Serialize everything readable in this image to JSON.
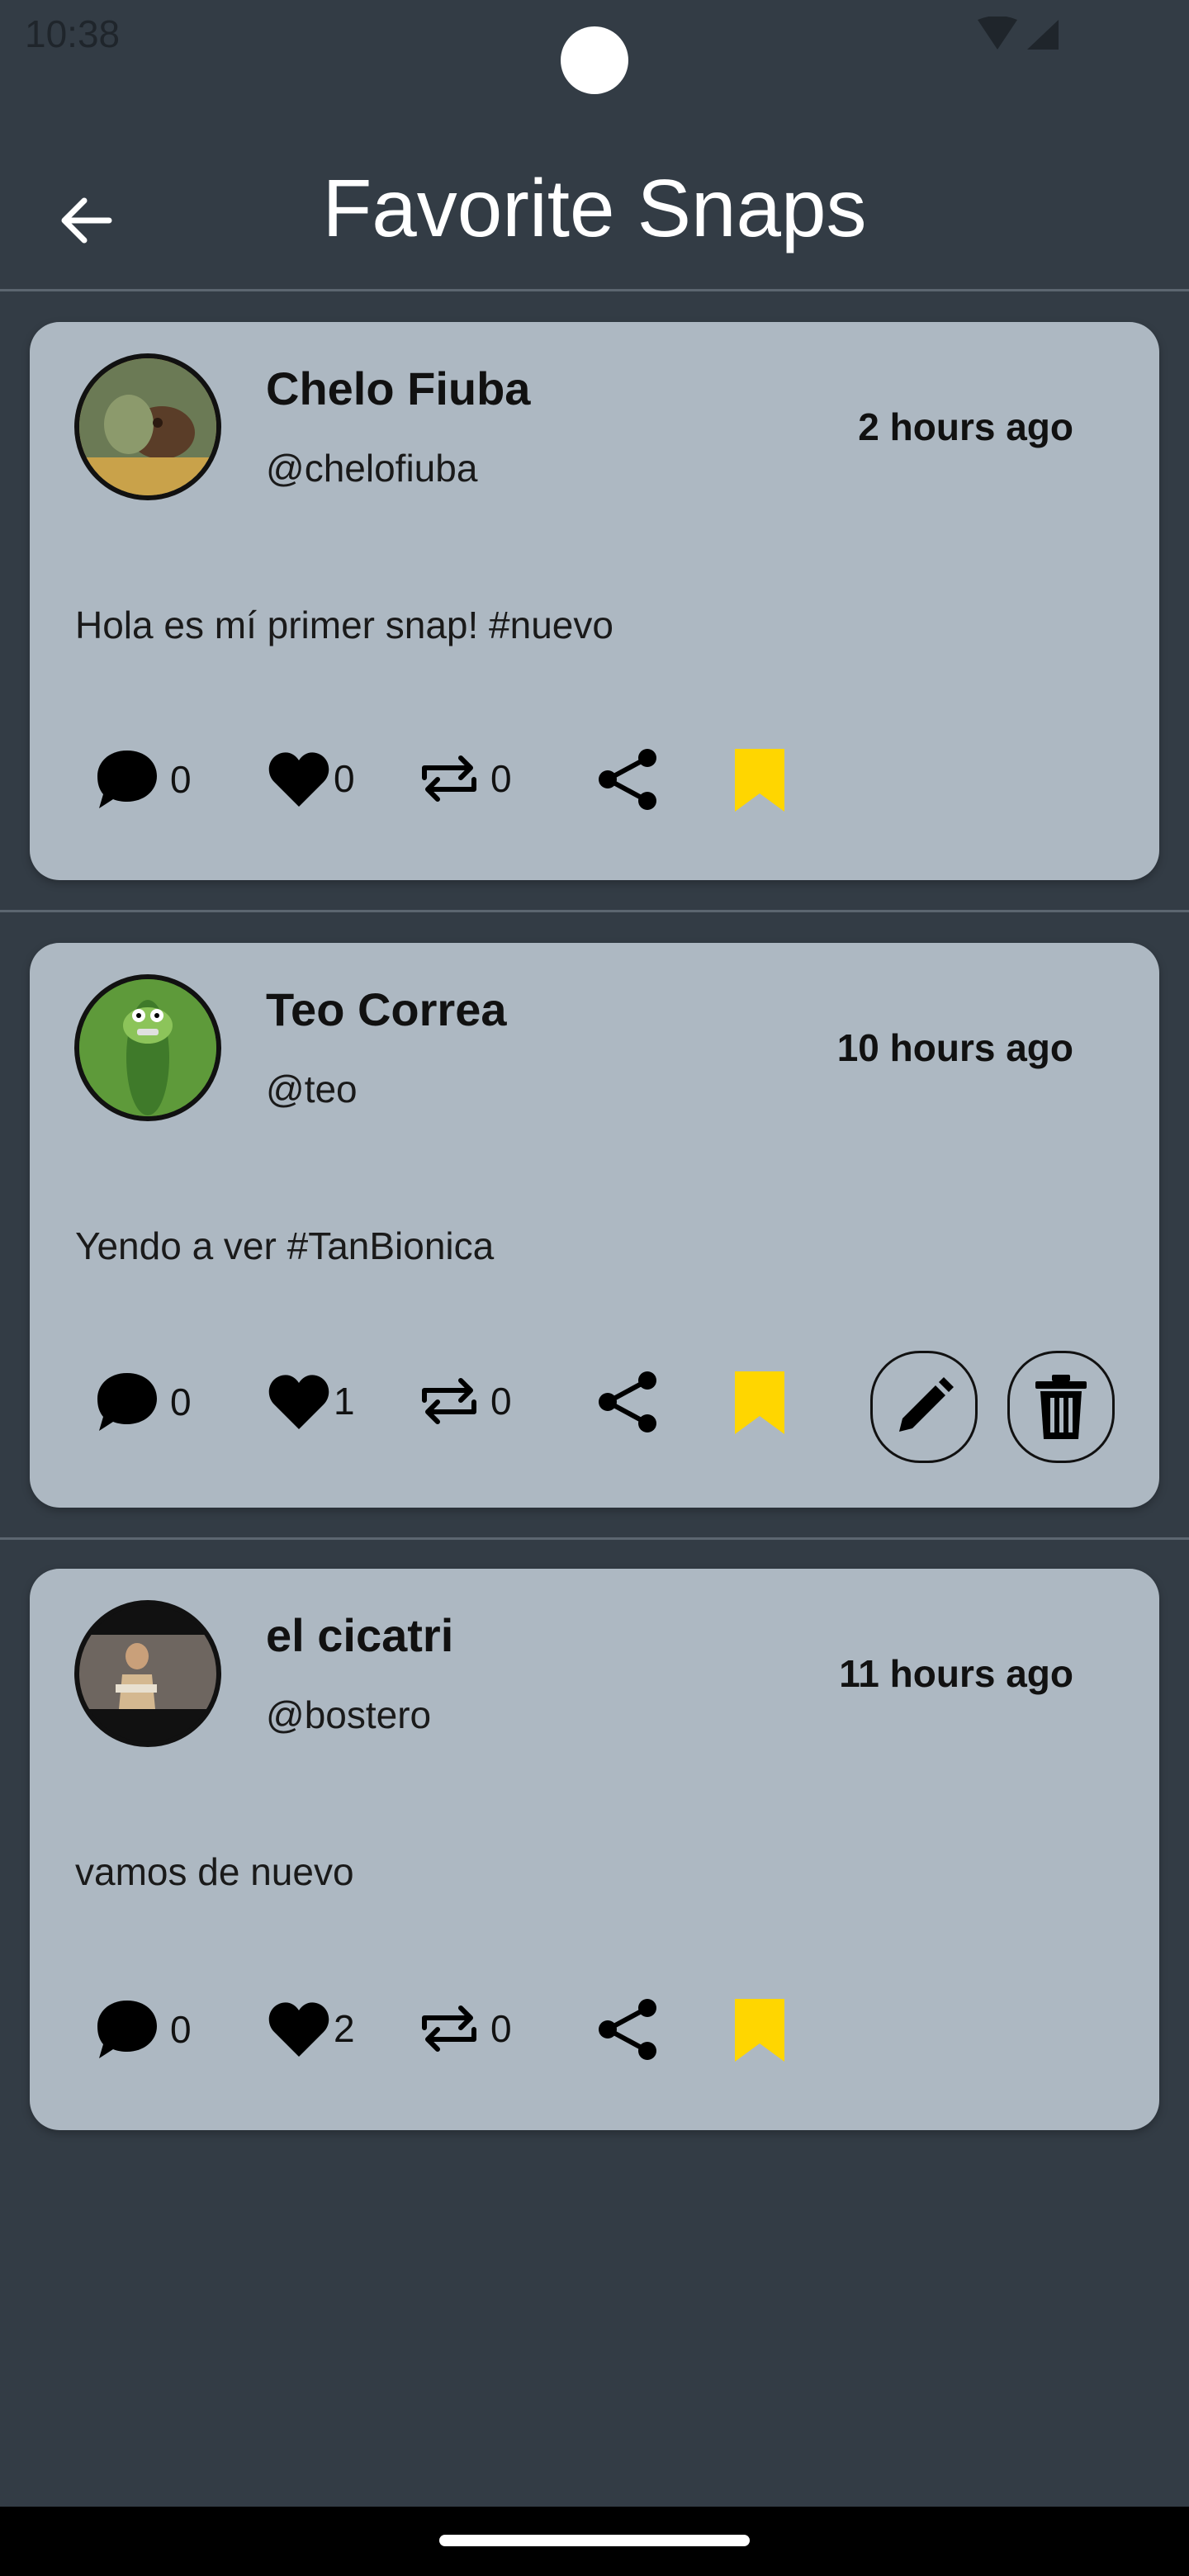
{
  "status_bar": {
    "time": "10:38"
  },
  "header": {
    "title": "Favorite Snaps",
    "back_icon": "arrow-left-icon"
  },
  "colors": {
    "background": "#333c45",
    "card": "#adb8c2",
    "bookmark": "#ffd600",
    "title": "#ffffff"
  },
  "snaps": [
    {
      "name": "Chelo Fiuba",
      "handle": "@chelofiuba",
      "time": "2 hours ago",
      "text": "Hola es mí primer snap! #nuevo",
      "comments": "0",
      "likes": "0",
      "resnaps": "0",
      "favorited": true,
      "editable": false
    },
    {
      "name": "Teo Correa",
      "handle": "@teo",
      "time": "10 hours ago",
      "text": "Yendo a ver #TanBionica",
      "comments": "0",
      "likes": "1",
      "resnaps": "0",
      "favorited": true,
      "editable": true
    },
    {
      "name": "el cicatri",
      "handle": "@bostero",
      "time": "11 hours ago",
      "text": "vamos de nuevo",
      "comments": "0",
      "likes": "2",
      "resnaps": "0",
      "favorited": true,
      "editable": false
    }
  ]
}
